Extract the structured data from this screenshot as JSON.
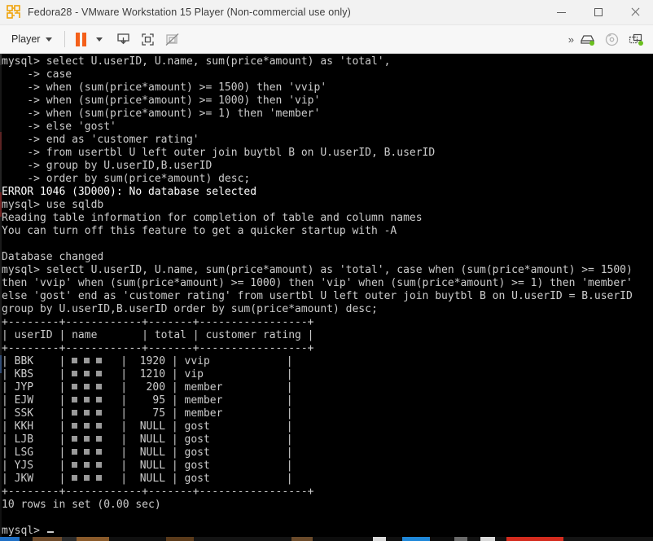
{
  "window": {
    "title": "Fedora28 - VMware Workstation 15 Player (Non-commercial use only)",
    "app_icon": "vmware-player-icon",
    "minimize_label": "Minimize",
    "maximize_label": "Maximize",
    "close_label": "Close"
  },
  "toolbar": {
    "player_label": "Player",
    "player_caret": "chevron-down-icon",
    "pause_label": "pause-icon",
    "pause_caret": "chevron-down-icon",
    "icons": [
      {
        "name": "send-ctrl-alt-del-icon",
        "label": "Send Ctrl+Alt+Del"
      },
      {
        "name": "fullscreen-icon",
        "label": "Enter Full Screen"
      },
      {
        "name": "unity-mode-disabled-icon",
        "label": "Unity Mode"
      }
    ],
    "right_icons": [
      {
        "name": "expand-toolbar-icon",
        "label": ">>"
      },
      {
        "name": "hard-disk-icon",
        "label": "Hard Disk",
        "status_color": "#6abf1e"
      },
      {
        "name": "cd-dvd-icon",
        "label": "CD/DVD",
        "status_color": "#9a9a9a"
      },
      {
        "name": "network-adapter-icon",
        "label": "Network Adapter",
        "status_color": "#6abf1e"
      }
    ]
  },
  "terminal": {
    "colors": {
      "background": "#000000",
      "foreground": "#cccccc",
      "bright": "#ffffff"
    },
    "lines": [
      {
        "text": "mysql> select U.userID, U.name, sum(price*amount) as 'total',",
        "style": "normal"
      },
      {
        "text": "    -> case",
        "style": "normal"
      },
      {
        "text": "    -> when (sum(price*amount) >= 1500) then 'vvip'",
        "style": "normal"
      },
      {
        "text": "    -> when (sum(price*amount) >= 1000) then 'vip'",
        "style": "normal"
      },
      {
        "text": "    -> when (sum(price*amount) >= 1) then 'member'",
        "style": "normal"
      },
      {
        "text": "    -> else 'gost'",
        "style": "normal"
      },
      {
        "text": "    -> end as 'customer rating'",
        "style": "normal"
      },
      {
        "text": "    -> from usertbl U left outer join buytbl B on U.userID, B.userID",
        "style": "normal"
      },
      {
        "text": "    -> group by U.userID,B.userID",
        "style": "normal"
      },
      {
        "text": "    -> order by sum(price*amount) desc;",
        "style": "normal"
      },
      {
        "text": "ERROR 1046 (3D000): No database selected",
        "style": "bright"
      },
      {
        "text": "mysql> use sqldb",
        "style": "normal"
      },
      {
        "text": "Reading table information for completion of table and column names",
        "style": "normal"
      },
      {
        "text": "You can turn off this feature to get a quicker startup with -A",
        "style": "normal"
      },
      {
        "text": "",
        "style": "normal"
      },
      {
        "text": "Database changed",
        "style": "normal"
      },
      {
        "text": "mysql> select U.userID, U.name, sum(price*amount) as 'total', case when (sum(price*amount) >= 1500)",
        "style": "normal"
      },
      {
        "text": "then 'vvip' when (sum(price*amount) >= 1000) then 'vip' when (sum(price*amount) >= 1) then 'member'",
        "style": "normal"
      },
      {
        "text": "else 'gost' end as 'customer rating' from usertbl U left outer join buytbl B on U.userID = B.userID",
        "style": "normal"
      },
      {
        "text": "group by U.userID,B.userID order by sum(price*amount) desc;",
        "style": "normal"
      }
    ],
    "result_table": {
      "top_rule": "+--------+------------+-------+-----------------+",
      "header": "| userID | name       | total | customer rating |",
      "header_rule": "+--------+------------+-------+-----------------+",
      "bottom_rule": "+--------+------------+-------+-----------------+",
      "columns": [
        "userID",
        "name",
        "total",
        "customer rating"
      ],
      "rows": [
        {
          "userID": "BBK",
          "name": "█ █ █",
          "total": "1920",
          "rating": "vvip"
        },
        {
          "userID": "KBS",
          "name": "█ █ █",
          "total": "1210",
          "rating": "vip"
        },
        {
          "userID": "JYP",
          "name": "█ █ █",
          "total": "200",
          "rating": "member"
        },
        {
          "userID": "EJW",
          "name": "█ █ █",
          "total": "95",
          "rating": "member"
        },
        {
          "userID": "SSK",
          "name": "█ █ █",
          "total": "75",
          "rating": "member"
        },
        {
          "userID": "KKH",
          "name": "█ █ █",
          "total": "NULL",
          "rating": "gost"
        },
        {
          "userID": "LJB",
          "name": "█ █ █",
          "total": "NULL",
          "rating": "gost"
        },
        {
          "userID": "LSG",
          "name": "█ █ █",
          "total": "NULL",
          "rating": "gost"
        },
        {
          "userID": "YJS",
          "name": "█ █ █",
          "total": "NULL",
          "rating": "gost"
        },
        {
          "userID": "JKW",
          "name": "█ █ █",
          "total": "NULL",
          "rating": "gost"
        }
      ]
    },
    "row_count_text": "10 rows in set (0.00 sec)",
    "blank_after_count": "",
    "final_prompt": "mysql> ",
    "cursor": "block-cursor"
  }
}
